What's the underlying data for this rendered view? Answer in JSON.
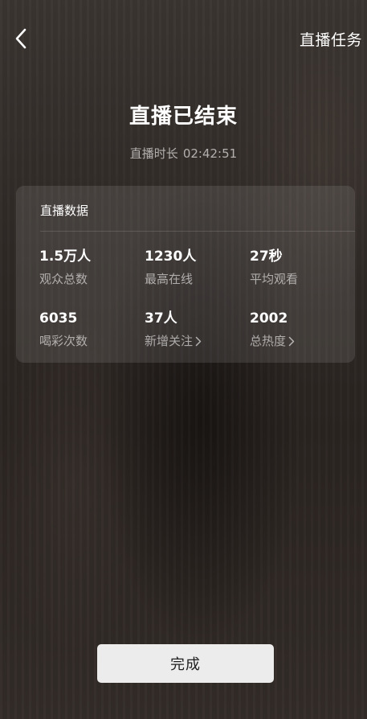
{
  "header": {
    "back_icon": "chevron-left-icon",
    "tasks_link": "直播任务"
  },
  "summary": {
    "title": "直播已结束",
    "duration_label": "直播时长",
    "duration_value": "02:42:51"
  },
  "stats_card": {
    "title": "直播数据",
    "items": [
      {
        "value": "1.5万人",
        "label": "观众总数",
        "has_arrow": false
      },
      {
        "value": "1230人",
        "label": "最高在线",
        "has_arrow": false
      },
      {
        "value": "27秒",
        "label": "平均观看",
        "has_arrow": false
      },
      {
        "value": "6035",
        "label": "喝彩次数",
        "has_arrow": false
      },
      {
        "value": "37人",
        "label": "新增关注",
        "has_arrow": true
      },
      {
        "value": "2002",
        "label": "总热度",
        "has_arrow": true
      }
    ]
  },
  "footer": {
    "done_label": "完成"
  }
}
